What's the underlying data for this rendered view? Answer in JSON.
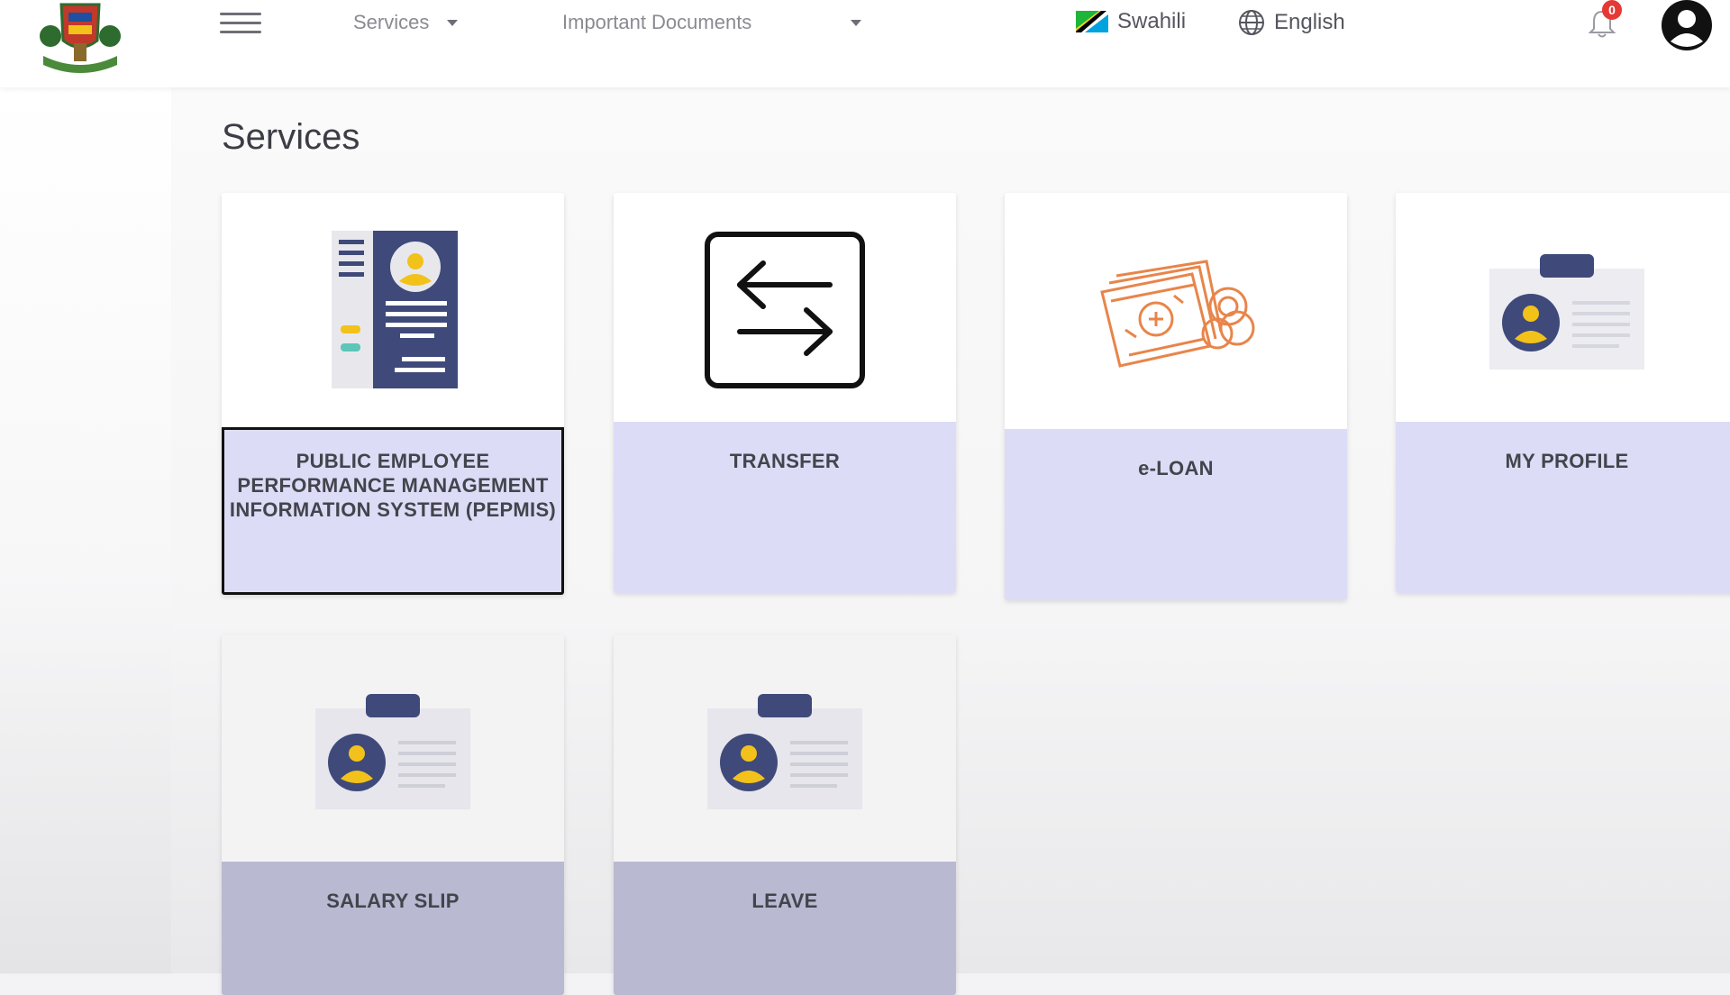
{
  "header": {
    "services_menu": "Services",
    "documents_menu": "Important Documents",
    "lang_swahili": "Swahili",
    "lang_english": "English",
    "notification_count": "0"
  },
  "page_title": "Services",
  "cards": [
    {
      "label": "PUBLIC EMPLOYEE PERFORMANCE MANAGEMENT INFORMATION SYSTEM (PEPMIS)",
      "icon": "id-document-icon"
    },
    {
      "label": "TRANSFER",
      "icon": "transfer-arrows-icon"
    },
    {
      "label": "e-LOAN",
      "icon": "money-icon"
    },
    {
      "label": "MY PROFILE",
      "icon": "id-badge-icon"
    },
    {
      "label": "SALARY SLIP",
      "icon": "id-badge-icon"
    },
    {
      "label": "LEAVE",
      "icon": "id-badge-icon"
    }
  ],
  "colors": {
    "card_label_bg": "#dcdcf7",
    "accent_dark": "#3f4a7a",
    "accent_yellow": "#f2c21b",
    "badge_red": "#e53935"
  }
}
